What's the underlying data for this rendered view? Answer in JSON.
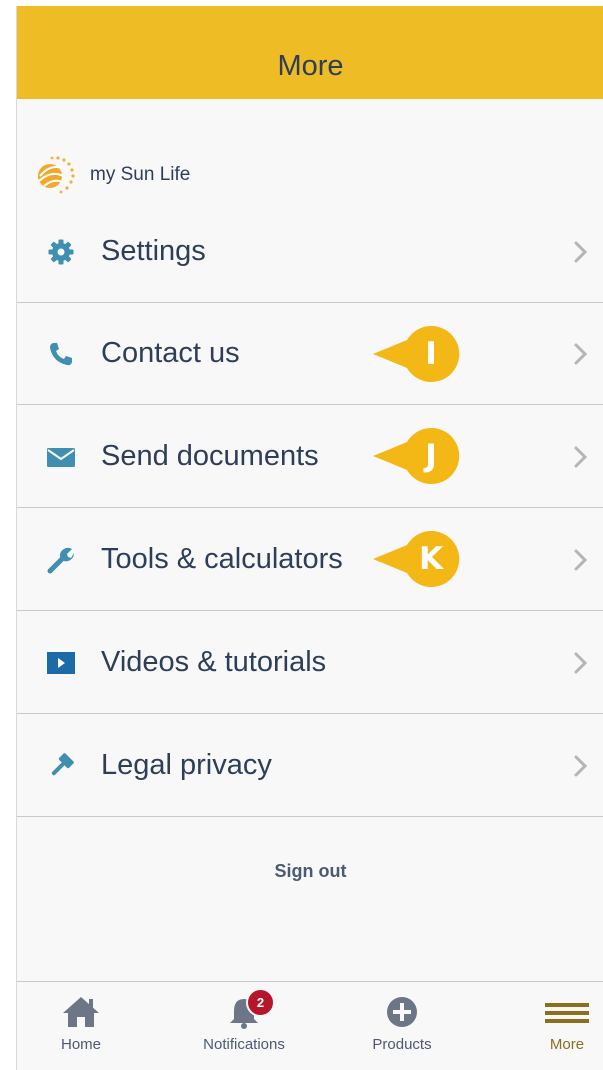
{
  "header": {
    "title": "More"
  },
  "brand": {
    "name": "my Sun Life",
    "logo_icon": "sun-life-logo"
  },
  "colors": {
    "header_bg": "#eebc25",
    "text": "#2f3e58",
    "icon": "#3f8fb0",
    "callout": "#f3b716",
    "badge": "#b5162b",
    "active_tab": "#8a6f1e"
  },
  "menu": {
    "items": [
      {
        "label": "Settings",
        "icon": "gear-icon"
      },
      {
        "label": "Contact us",
        "icon": "phone-icon",
        "callout": "I"
      },
      {
        "label": "Send documents",
        "icon": "envelope-icon",
        "callout": "J"
      },
      {
        "label": "Tools & calculators",
        "icon": "wrench-icon",
        "callout": "K"
      },
      {
        "label": "Videos & tutorials",
        "icon": "video-icon"
      },
      {
        "label": "Legal privacy",
        "icon": "gavel-icon"
      }
    ]
  },
  "signout": {
    "label": "Sign out"
  },
  "tabbar": {
    "tabs": [
      {
        "label": "Home",
        "icon": "home-icon"
      },
      {
        "label": "Notifications",
        "icon": "bell-icon",
        "badge": "2"
      },
      {
        "label": "Products",
        "icon": "plus-circle-icon"
      },
      {
        "label": "More",
        "icon": "menu-icon",
        "active": true
      }
    ]
  }
}
